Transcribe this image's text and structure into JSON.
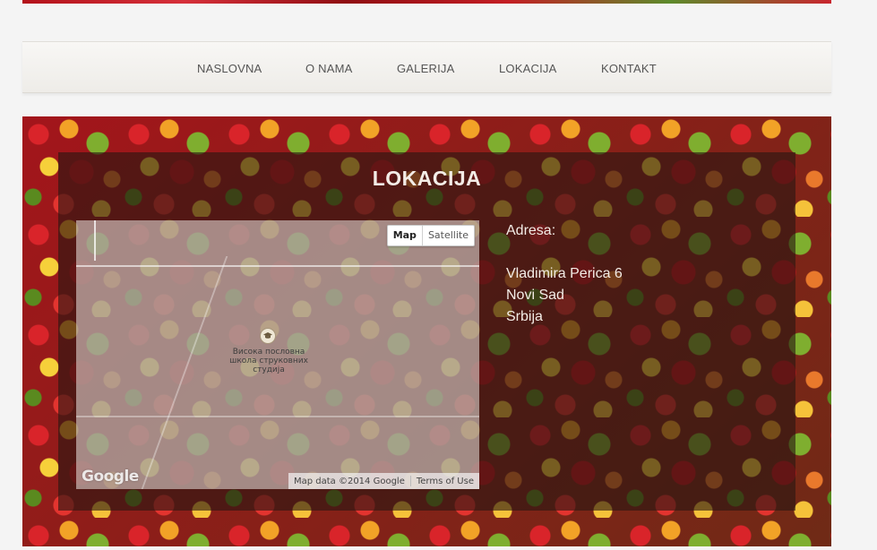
{
  "nav": {
    "items": [
      {
        "label": "NASLOVNA"
      },
      {
        "label": "O NAMA"
      },
      {
        "label": "GALERIJA"
      },
      {
        "label": "LOKACIJA"
      },
      {
        "label": "KONTAKT"
      }
    ]
  },
  "section": {
    "title": "LOKACIJA"
  },
  "map": {
    "map_button": "Map",
    "satellite_button": "Satellite",
    "poi_label": "Висока пословна школа струковних студија",
    "logo": "Google",
    "attribution": "Map data ©2014 Google",
    "terms": "Terms of Use"
  },
  "address": {
    "heading": "Adresa:",
    "line1": "Vladimira Perica 6",
    "line2": "Novi Sad",
    "line3": "Srbija"
  },
  "colors": {
    "panel_text": "#f3ece6",
    "nav_text": "#555555"
  }
}
